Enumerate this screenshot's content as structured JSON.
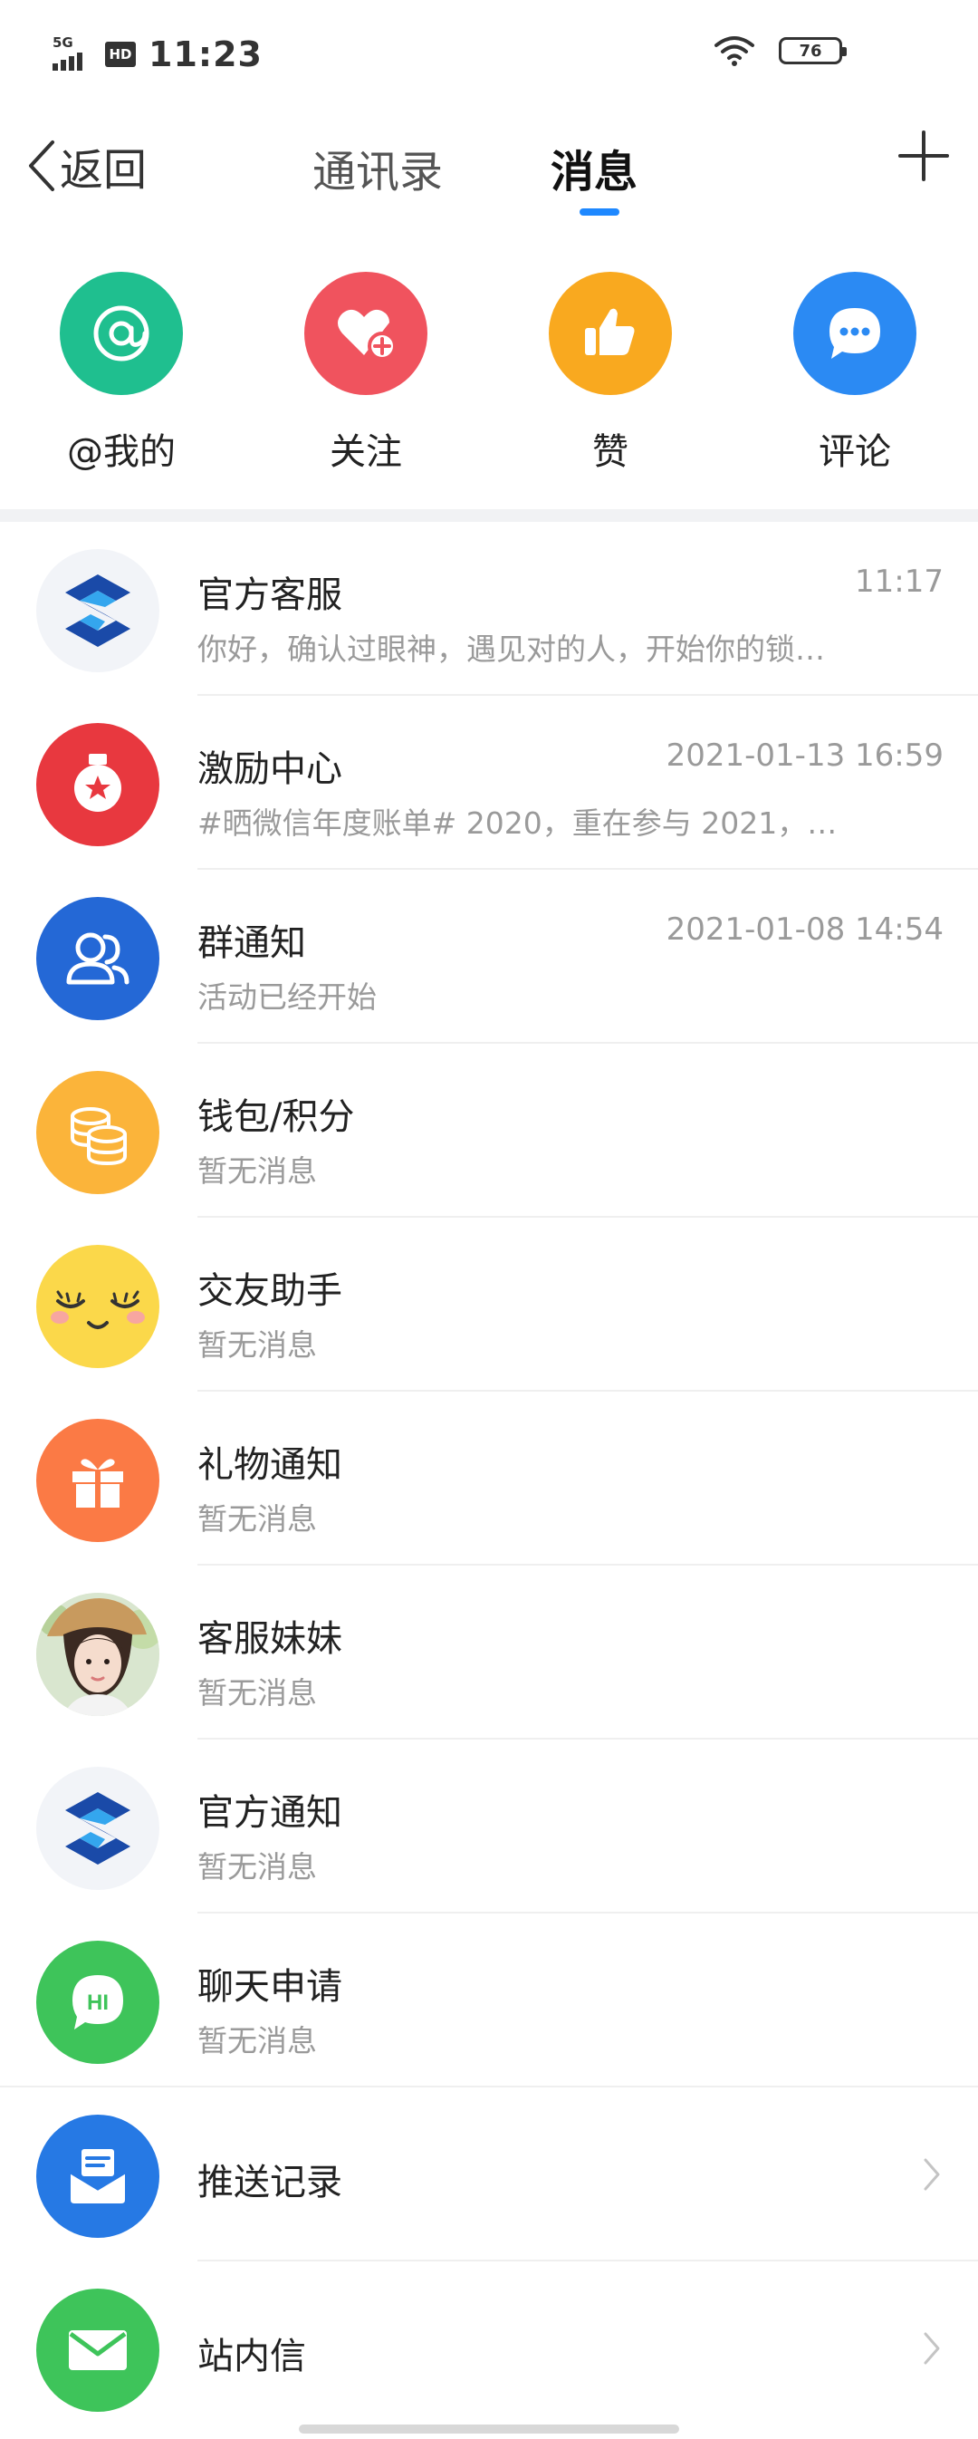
{
  "status_bar": {
    "network": "5G",
    "hd": "HD",
    "time": "11:23",
    "battery": "76"
  },
  "nav": {
    "back_label": "返回",
    "tabs": [
      "通讯录",
      "消息"
    ],
    "active_tab": "消息"
  },
  "quick_actions": [
    {
      "label": "@我的",
      "icon": "at-icon",
      "color": "#1fbf8f"
    },
    {
      "label": "关注",
      "icon": "heart-plus-icon",
      "color": "#f0535e"
    },
    {
      "label": "赞",
      "icon": "thumbs-up-icon",
      "color": "#f9a91f"
    },
    {
      "label": "评论",
      "icon": "comment-icon",
      "color": "#2b8af3"
    }
  ],
  "messages": [
    {
      "title": "官方客服",
      "preview": "你好，确认过眼神，遇见对的人，开始你的锁…",
      "time": "11:17",
      "icon": "official-logo-icon"
    },
    {
      "title": "激励中心",
      "preview": "#晒微信年度账单# 2020，重在参与 2021，…",
      "time": "2021-01-13 16:59",
      "icon": "medal-icon"
    },
    {
      "title": "群通知",
      "preview": "活动已经开始",
      "time": "2021-01-08 14:54",
      "icon": "group-icon"
    },
    {
      "title": "钱包/积分",
      "preview": "暂无消息",
      "time": "",
      "icon": "coins-icon"
    },
    {
      "title": "交友助手",
      "preview": "暂无消息",
      "time": "",
      "icon": "smiley-icon"
    },
    {
      "title": "礼物通知",
      "preview": "暂无消息",
      "time": "",
      "icon": "gift-icon"
    },
    {
      "title": "客服妹妹",
      "preview": "暂无消息",
      "time": "",
      "icon": "user-avatar-icon"
    },
    {
      "title": "官方通知",
      "preview": "暂无消息",
      "time": "",
      "icon": "official-logo-icon"
    },
    {
      "title": "聊天申请",
      "preview": "暂无消息",
      "time": "",
      "icon": "hi-chat-icon"
    }
  ],
  "links": [
    {
      "title": "推送记录",
      "icon": "push-inbox-icon"
    },
    {
      "title": "站内信",
      "icon": "envelope-icon"
    }
  ],
  "colors": {
    "accent": "#1e88ff",
    "separator": "#efefef",
    "muted_text": "#9a9a9a"
  }
}
